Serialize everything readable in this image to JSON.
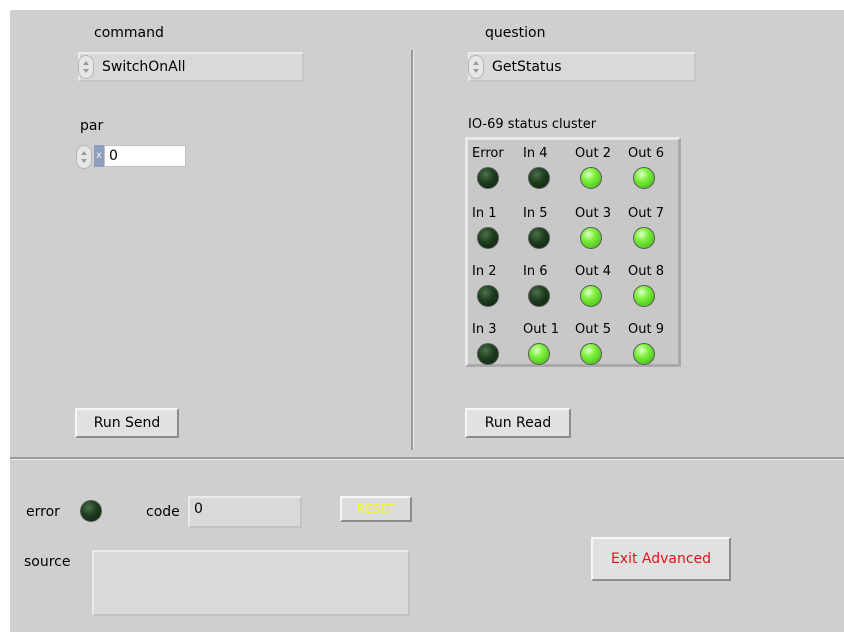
{
  "send": {
    "command_label": "command",
    "command_value": "SwitchOnAll",
    "par_label": "par",
    "par_prefix": "x",
    "par_value": "0",
    "run_label": "Run Send"
  },
  "read": {
    "question_label": "question",
    "question_value": "GetStatus",
    "cluster_label": "IO-69 status cluster",
    "run_label": "Run Read",
    "indicators": [
      {
        "label": "Error",
        "state": "off"
      },
      {
        "label": "In 4",
        "state": "off"
      },
      {
        "label": "Out 2",
        "state": "on"
      },
      {
        "label": "Out 6",
        "state": "on"
      },
      {
        "label": "In 1",
        "state": "off"
      },
      {
        "label": "In 5",
        "state": "off"
      },
      {
        "label": "Out 3",
        "state": "on"
      },
      {
        "label": "Out 7",
        "state": "on"
      },
      {
        "label": "In 2",
        "state": "off"
      },
      {
        "label": "In 6",
        "state": "off"
      },
      {
        "label": "Out 4",
        "state": "on"
      },
      {
        "label": "Out 8",
        "state": "on"
      },
      {
        "label": "In 3",
        "state": "off"
      },
      {
        "label": "Out 1",
        "state": "on"
      },
      {
        "label": "Out 5",
        "state": "on"
      },
      {
        "label": "Out 9",
        "state": "on"
      }
    ]
  },
  "error": {
    "error_label": "error",
    "error_state": "off",
    "code_label": "code",
    "code_value": "0",
    "reset_label": "RESET",
    "source_label": "source",
    "source_value": ""
  },
  "exit_label": "Exit Advanced",
  "colors": {
    "panel": "#cfcfcf",
    "led_on": "#7ef03c",
    "led_off": "#1d3d1d",
    "reset_text": "#f5f53a",
    "exit_text": "#e0141c"
  }
}
